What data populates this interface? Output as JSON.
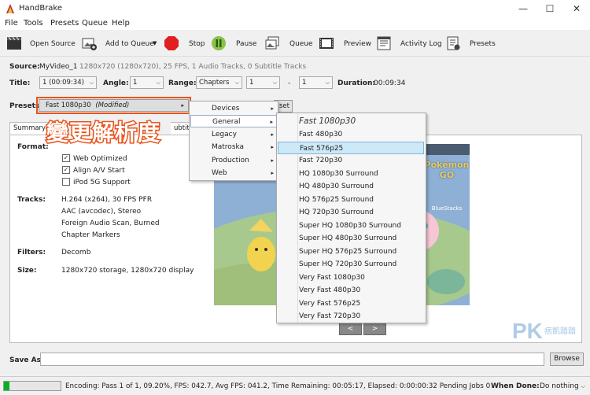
{
  "window": {
    "title": "HandBrake",
    "minimize": "—",
    "maximize": "☐",
    "close": "✕"
  },
  "menubar": [
    "File",
    "Tools",
    "Presets",
    "Queue",
    "Help"
  ],
  "toolbar": {
    "open_source": "Open Source",
    "add_to_queue": "Add to Queue",
    "stop": "Stop",
    "pause": "Pause",
    "queue": "Queue",
    "preview": "Preview",
    "activity_log": "Activity Log",
    "presets": "Presets"
  },
  "source": {
    "label": "Source:",
    "name": "MyVideo_1",
    "info": "1280x720 (1280x720), 25 FPS, 1 Audio Tracks, 0 Subtitle Tracks"
  },
  "title_row": {
    "title_label": "Title:",
    "title_value": "1 (00:09:34)",
    "angle_label": "Angle:",
    "angle_value": "1",
    "range_label": "Range:",
    "range_mode": "Chapters",
    "range_start": "1",
    "range_dash": "-",
    "range_end": "1",
    "duration_label": "Duration:",
    "duration_value": "00:09:34"
  },
  "presets_row": {
    "label": "Presets:",
    "value_name": "Fast 1080p30",
    "value_modified": "(Modified)",
    "hidden_button_partial": "set"
  },
  "annotation": "變更解析度",
  "tabs": {
    "summary": "Summary",
    "subtitles_partial": "ubtitl"
  },
  "summary": {
    "format_label": "Format:",
    "web_optimized": "Web Optimized",
    "align_av": "Align A/V Start",
    "ipod": "iPod 5G Support",
    "tracks_label": "Tracks:",
    "tracks": [
      "H.264 (x264), 30 FPS PFR",
      "AAC (avcodec), Stereo",
      "Foreign Audio Scan, Burned",
      "Chapter Markers"
    ],
    "filters_label": "Filters:",
    "filters_value": "Decomb",
    "size_label": "Size:",
    "size_value": "1280x720 storage, 1280x720 display"
  },
  "preview": {
    "logo_text": "Pokémon GO",
    "brand": "BlueStacks",
    "prev": "<",
    "next": ">"
  },
  "category_menu": [
    "Devices",
    "General",
    "Legacy",
    "Matroska",
    "Production",
    "Web"
  ],
  "general_menu": {
    "header": "Fast 1080p30",
    "items": [
      "Fast 480p30",
      "Fast 576p25",
      "Fast 720p30",
      "HQ 1080p30 Surround",
      "HQ 480p30 Surround",
      "HQ 576p25 Surround",
      "HQ 720p30 Surround",
      "Super HQ 1080p30 Surround",
      "Super HQ 480p30 Surround",
      "Super HQ 576p25 Surround",
      "Super HQ 720p30 Surround",
      "Very Fast 1080p30",
      "Very Fast 480p30",
      "Very Fast 576p25",
      "Very Fast 720p30"
    ],
    "selected": "Fast 576p25"
  },
  "save_as": {
    "label": "Save As:",
    "value": "",
    "browse": "Browse"
  },
  "watermark": {
    "letters": "PK",
    "text": "痞凱踏踏"
  },
  "status": {
    "progress": 0.092,
    "text": "Encoding: Pass 1 of 1,  09.20%, FPS: 042.7,  Avg FPS: 041.2,  Time Remaining: 00:05:17,  Elapsed: 0:00:00:32   Pending Jobs 0",
    "when_done_label": "When Done:",
    "when_done_value": "Do nothing"
  },
  "colors": {
    "accent": "#e8541c",
    "selection": "#cde8f7",
    "progress": "#06b025"
  }
}
